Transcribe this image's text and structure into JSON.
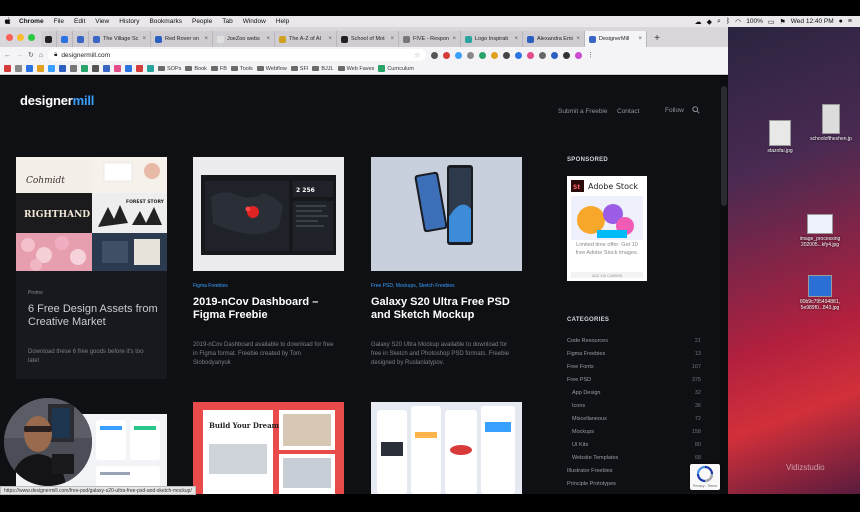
{
  "menubar": {
    "apple": "",
    "items": [
      "Chrome",
      "File",
      "Edit",
      "View",
      "History",
      "Bookmarks",
      "People",
      "Tab",
      "Window",
      "Help"
    ],
    "battery": "100%",
    "clock": "Wed 12:40 PM"
  },
  "tabs": [
    {
      "label": "The Village Sc",
      "color": "#3a66c4"
    },
    {
      "label": "Red Rover on",
      "color": "#2b5fc0"
    },
    {
      "label": "JoeZoo webs",
      "color": "#e0e0e0"
    },
    {
      "label": "The A-Z of Al",
      "color": "#d0a020"
    },
    {
      "label": "School of Mot",
      "color": "#222222"
    },
    {
      "label": "FIVE - Respon",
      "color": "#777777"
    },
    {
      "label": "Logo Inspirati",
      "color": "#2aa39c"
    },
    {
      "label": "Alexandra Emi",
      "color": "#2b5fc0"
    },
    {
      "label": "DesignerMill",
      "color": "#3a66c4"
    }
  ],
  "address": {
    "url": "designermill.com"
  },
  "bookmarks": {
    "folders": [
      "SOPs",
      "Book",
      "FB",
      "Tools",
      "Webflow",
      "SFI",
      "BJJL",
      "Web Faves",
      "Curriculum"
    ]
  },
  "site": {
    "logo_a": "designer",
    "logo_b": "mill",
    "nav": {
      "submit": "Submit a Freebie",
      "contact": "Contact",
      "follow": "Follow"
    },
    "cards": [
      {
        "category": "Promo",
        "title": "6 Free Design Assets from Creative Market",
        "desc": "Download these 6 free goods before it's too late!"
      },
      {
        "category": "Figma Freebies",
        "title": "2019-nCov Dashboard – Figma Freebie",
        "desc": "2019-nCov Dashboard available to download for free in Figma format. Freebie created by Tom Slobodyanyuk"
      },
      {
        "category": "Free PSD, Mockups, Sketch Freebies",
        "title": "Galaxy S20 Ultra Free PSD and Sketch Mockup",
        "desc": "Galaxy S20 Ultra Mockup available to download for free in Sketch and Photoshop PSD formats. Freebie designed by Ruslanlatypov."
      }
    ],
    "thumb_texts": {
      "cohmidt": "Cohmidt",
      "righthand": "RIGHTHAND",
      "forest": "FOREST STORY",
      "dash_num": "2 256",
      "build": "Build Your Dream House"
    },
    "sponsored": {
      "heading": "SPONSORED",
      "ad_brand": "Adobe Stock",
      "ad_brand_logo": "St",
      "ad_text": "Limited time offer: Get 10 free Adobe Stock images.",
      "ad_footer": "ADS VIA CARBON"
    },
    "categories": {
      "heading": "CATEGORIES",
      "items": [
        {
          "label": "Code Resources",
          "count": "21",
          "sub": false
        },
        {
          "label": "Figma Freebies",
          "count": "13",
          "sub": false
        },
        {
          "label": "Free Fonts",
          "count": "167",
          "sub": false
        },
        {
          "label": "Free PSD",
          "count": "375",
          "sub": false
        },
        {
          "label": "App Design",
          "count": "32",
          "sub": true
        },
        {
          "label": "Icons",
          "count": "36",
          "sub": true
        },
        {
          "label": "Miscellaneous",
          "count": "72",
          "sub": true
        },
        {
          "label": "Mockups",
          "count": "158",
          "sub": true
        },
        {
          "label": "UI Kits",
          "count": "80",
          "sub": true
        },
        {
          "label": "Website Templates",
          "count": "68",
          "sub": true
        },
        {
          "label": "Illustrator Freebies",
          "count": "",
          "sub": false
        },
        {
          "label": "Principle Prototypes",
          "count": "",
          "sub": false
        }
      ]
    }
  },
  "status_url": "https://www.designermill.com/free-psd/galaxy-s20-ultra-free-psd-and-sketch-mockup/",
  "recaptcha": {
    "label": "Privacy - Terms"
  },
  "desktop": {
    "files": [
      "stazofai.jpg",
      "schooloftheshen.jp",
      "image_processing 202005...kfy4.jpg",
      "80b9c795494881, 5e989f0...843.jpg"
    ],
    "watermark": "Vidizstudio"
  }
}
